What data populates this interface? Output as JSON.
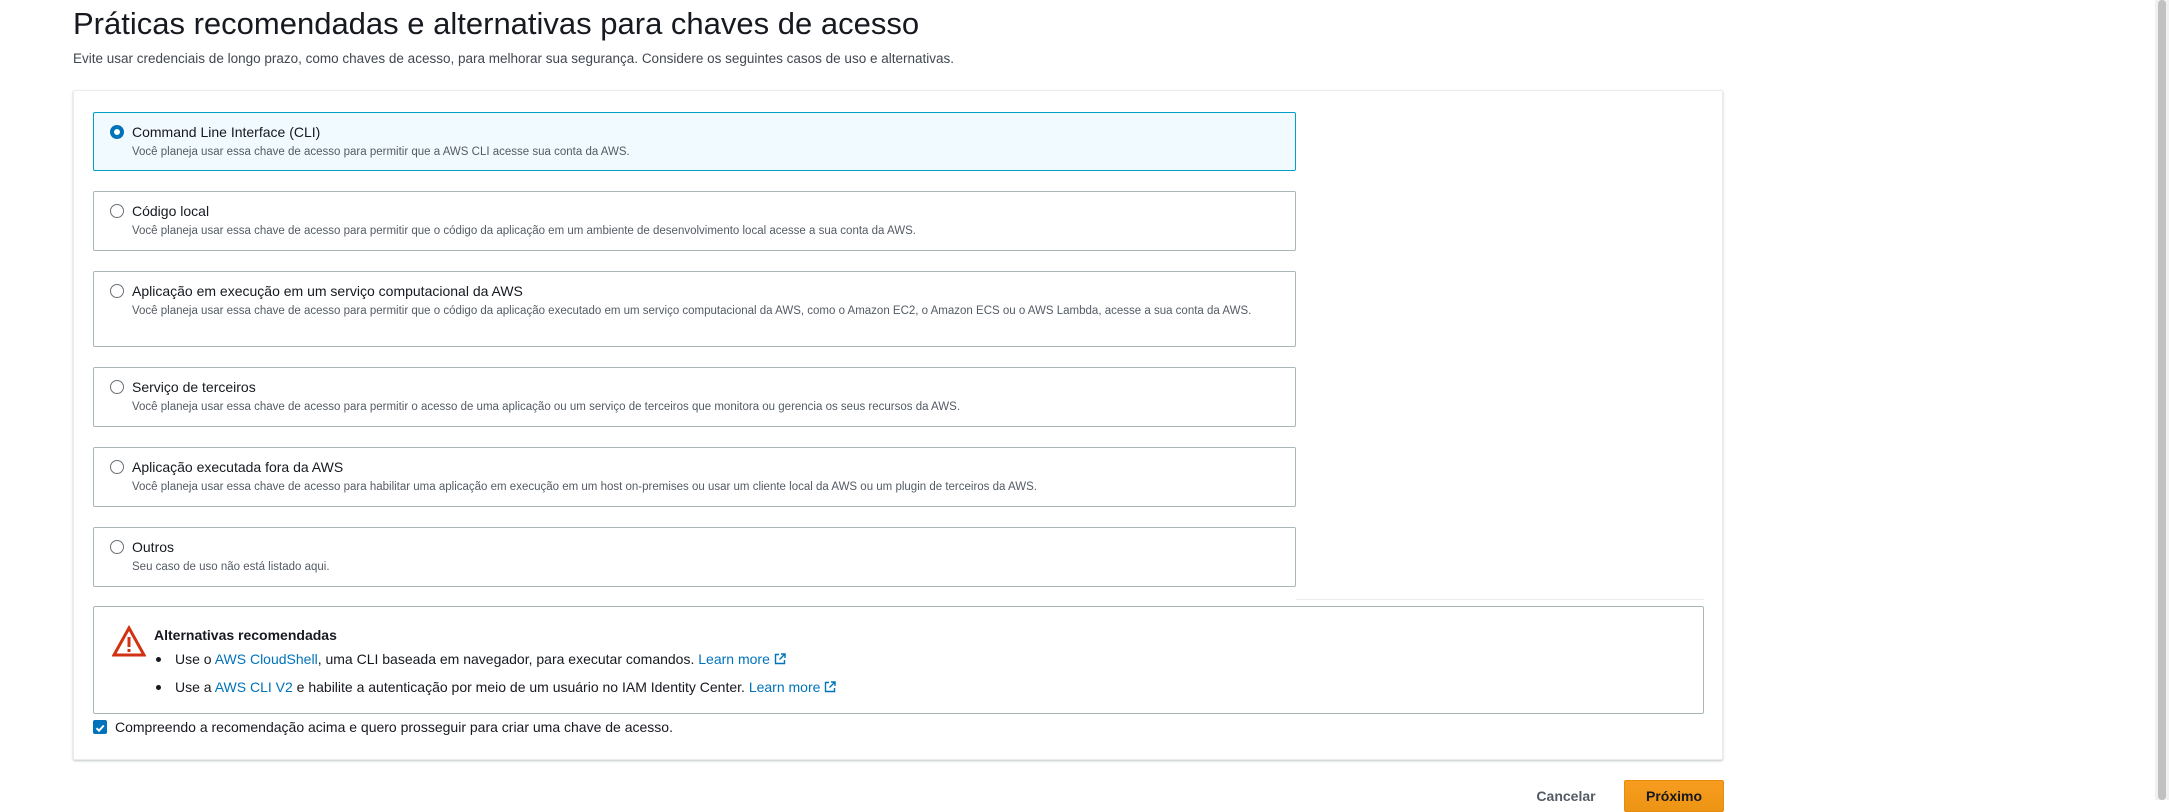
{
  "page": {
    "title": "Práticas recomendadas e alternativas para chaves de acesso",
    "description": "Evite usar credenciais de longo prazo, como chaves de acesso, para melhorar sua segurança. Considere os seguintes casos de uso e alternativas."
  },
  "options": [
    {
      "label": "Command Line Interface (CLI)",
      "description": "Você planeja usar essa chave de acesso para permitir que a AWS CLI acesse sua conta da AWS.",
      "selected": true
    },
    {
      "label": "Código local",
      "description": "Você planeja usar essa chave de acesso para permitir que o código da aplicação em um ambiente de desenvolvimento local acesse a sua conta da AWS.",
      "selected": false
    },
    {
      "label": "Aplicação em execução em um serviço computacional da AWS",
      "description": "Você planeja usar essa chave de acesso para permitir que o código da aplicação executado em um serviço computacional da AWS, como o Amazon EC2, o Amazon ECS ou o AWS Lambda, acesse a sua conta da AWS.",
      "selected": false
    },
    {
      "label": "Serviço de terceiros",
      "description": "Você planeja usar essa chave de acesso para permitir o acesso de uma aplicação ou um serviço de terceiros que monitora ou gerencia os seus recursos da AWS.",
      "selected": false
    },
    {
      "label": "Aplicação executada fora da AWS",
      "description": "Você planeja usar essa chave de acesso para habilitar uma aplicação em execução em um host on-premises ou usar um cliente local da AWS ou um plugin de terceiros da AWS.",
      "selected": false
    },
    {
      "label": "Outros",
      "description": "Seu caso de uso não está listado aqui.",
      "selected": false
    }
  ],
  "alternatives": {
    "title": "Alternativas recomendadas",
    "items": [
      {
        "prefix": "Use o ",
        "link_text": "AWS CloudShell",
        "suffix": ", uma CLI baseada em navegador, para executar comandos.",
        "learn_more": "Learn more"
      },
      {
        "prefix": "Use a ",
        "link_text": "AWS CLI V2",
        "suffix": " e habilite a autenticação por meio de um usuário no IAM Identity Center.",
        "learn_more": "Learn more"
      }
    ]
  },
  "acknowledgement": {
    "label": "Compreendo a recomendação acima e quero prosseguir para criar uma chave de acesso.",
    "checked": true
  },
  "footer": {
    "cancel_label": "Cancelar",
    "next_label": "Próximo"
  },
  "icons": {
    "warning": "warning-triangle-icon",
    "external_link": "external-link-icon",
    "checkmark": "checkmark-icon"
  },
  "colors": {
    "link": "#0073bb",
    "selected_border": "#00a1c9",
    "selected_bg": "#f1faff",
    "warning": "#d13212",
    "primary_button": "#ec7211"
  }
}
